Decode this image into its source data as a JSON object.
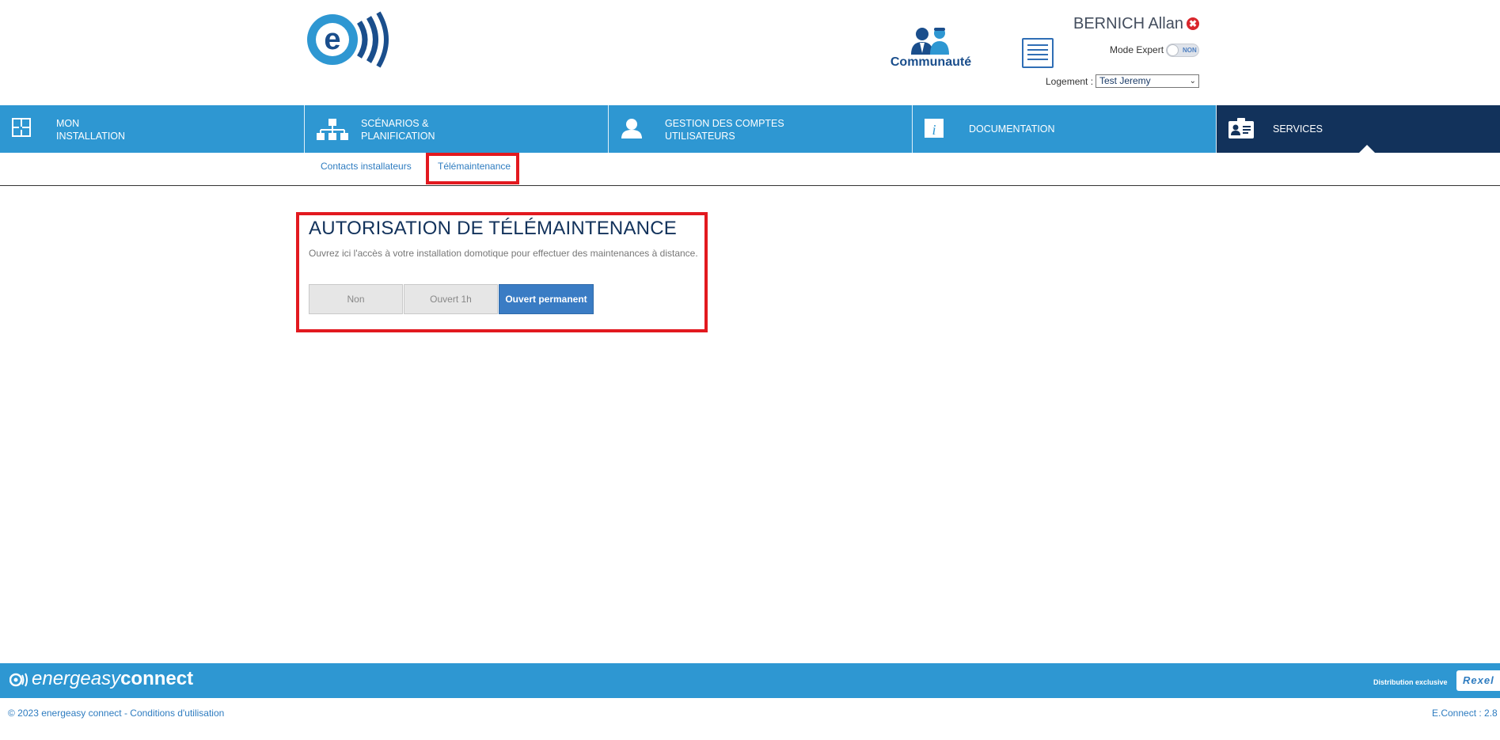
{
  "header": {
    "community_label": "Communauté",
    "user_name": "BERNICH Allan",
    "logout_symbol": "✖",
    "mode_expert_label": "Mode Expert",
    "mode_expert_state": "NON",
    "logement_label": "Logement :",
    "logement_selected": "Test Jeremy"
  },
  "nav": {
    "items": [
      {
        "line1": "MON",
        "line2": "INSTALLATION",
        "icon": "installation-icon"
      },
      {
        "line1": "SCÉNARIOS &",
        "line2": "PLANIFICATION",
        "icon": "scenarios-icon"
      },
      {
        "line1": "GESTION DES COMPTES",
        "line2": "UTILISATEURS",
        "icon": "user-icon"
      },
      {
        "line1": "DOCUMENTATION",
        "line2": "",
        "icon": "info-icon"
      },
      {
        "line1": "SERVICES",
        "line2": "",
        "icon": "services-icon"
      }
    ],
    "active_index": 4
  },
  "subnav": {
    "items": [
      "Contacts installateurs",
      "Télémaintenance"
    ],
    "active": "Télémaintenance"
  },
  "main": {
    "title": "AUTORISATION DE TÉLÉMAINTENANCE",
    "description": "Ouvrez ici l'accès à votre installation domotique pour effectuer des maintenances à distance.",
    "options": [
      "Non",
      "Ouvert 1h",
      "Ouvert permanent"
    ],
    "selected_option": "Ouvert permanent"
  },
  "footer": {
    "brand_thin": "energeasy",
    "brand_bold": "connect",
    "distribution_label": "Distribution exclusive",
    "partner": "Rexel",
    "copyright": "© 2023 energeasy connect - Conditions d'utilisation",
    "version": "E.Connect : 2.8"
  },
  "colors": {
    "nav_blue": "#2e97d2",
    "nav_active": "#12325b",
    "highlight_red": "#e2191f",
    "selected_button": "#3a7cc4"
  }
}
